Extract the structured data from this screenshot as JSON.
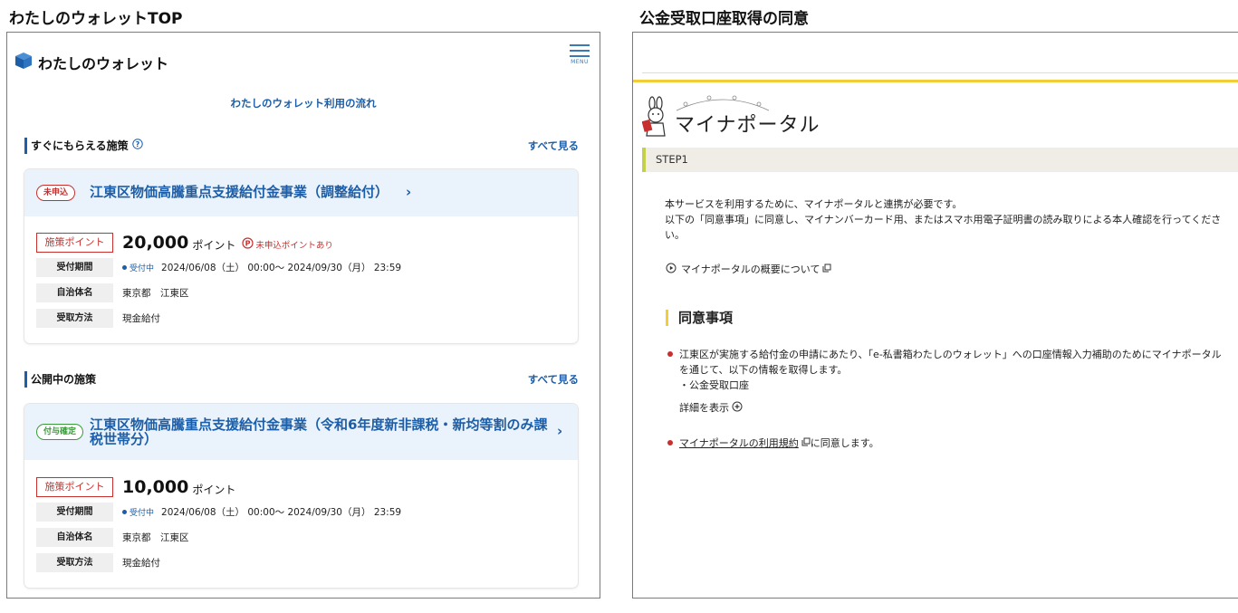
{
  "captions": {
    "left": "わたしのウォレットTOP",
    "right": "公金受取口座取得の同意"
  },
  "wallet": {
    "app_title": "わたしのウォレット",
    "menu_label": "MENU",
    "flow_link": "わたしのウォレット利用の流れ",
    "sections": [
      {
        "title": "すぐにもらえる施策",
        "see_all": "すべて見る",
        "card": {
          "badge": "未申込",
          "title": "江東区物価高騰重点支援給付金事業（調整給付）",
          "points_label": "施策ポイント",
          "points_value": "20,000",
          "points_unit": "ポイント",
          "unapplied_note": "未申込ポイントあり",
          "rows": [
            {
              "label": "受付期間",
              "status": "受付中",
              "value": "2024/06/08（土） 00:00～ 2024/09/30（月） 23:59"
            },
            {
              "label": "自治体名",
              "value": "東京都　江東区"
            },
            {
              "label": "受取方法",
              "value": "現金給付"
            }
          ]
        }
      },
      {
        "title": "公開中の施策",
        "see_all": "すべて見る",
        "card": {
          "badge": "付与確定",
          "title": "江東区物価高騰重点支援給付金事業（令和6年度新非課税・新均等割のみ課税世帯分）",
          "points_label": "施策ポイント",
          "points_value": "10,000",
          "points_unit": "ポイント",
          "rows": [
            {
              "label": "受付期間",
              "status": "受付中",
              "value": "2024/06/08（土） 00:00～ 2024/09/30（月） 23:59"
            },
            {
              "label": "自治体名",
              "value": "東京都　江東区"
            },
            {
              "label": "受取方法",
              "value": "現金給付"
            }
          ]
        }
      }
    ]
  },
  "myna": {
    "brand": "マイナポータル",
    "step": "STEP1",
    "intro_1": "本サービスを利用するために、マイナポータルと連携が必要です。",
    "intro_2": "以下の「同意事項」に同意し、マイナンバーカード用、またはスマホ用電子証明書の読み取りによる本人確認を行ってください。",
    "about_link": "マイナポータルの概要について",
    "agree_heading": "同意事項",
    "agree_item_1": "江東区が実施する給付金の申請にあたり、「e-私書箱わたしのウォレット」への口座情報入力補助のためにマイナポータルを通じて、以下の情報を取得します。",
    "agree_item_1_sub": "・公金受取口座",
    "detail_toggle": "詳細を表示",
    "terms_link": "マイナポータルの利用規約",
    "terms_suffix": "に同意します。"
  },
  "colors": {
    "accent_blue": "#1c5ea8",
    "alert_red": "#c8302e",
    "confirmed_green": "#3a9b3a",
    "myna_yellow": "#f3cd37"
  }
}
